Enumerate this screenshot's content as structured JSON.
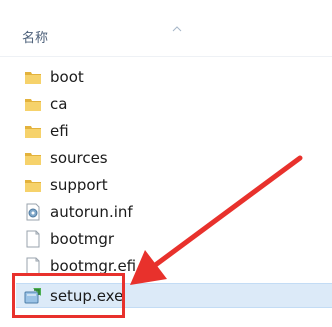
{
  "header": {
    "column_name": "名称"
  },
  "files": [
    {
      "name": "boot",
      "type": "folder",
      "icon": "folder-icon"
    },
    {
      "name": "ca",
      "type": "folder",
      "icon": "folder-icon"
    },
    {
      "name": "efi",
      "type": "folder",
      "icon": "folder-icon"
    },
    {
      "name": "sources",
      "type": "folder",
      "icon": "folder-icon"
    },
    {
      "name": "support",
      "type": "folder",
      "icon": "folder-icon"
    },
    {
      "name": "autorun.inf",
      "type": "file",
      "icon": "settings-file-icon"
    },
    {
      "name": "bootmgr",
      "type": "file",
      "icon": "blank-file-icon"
    },
    {
      "name": "bootmgr.efi",
      "type": "file",
      "icon": "blank-file-icon"
    },
    {
      "name": "setup.exe",
      "type": "exe",
      "icon": "setup-exe-icon",
      "selected": true
    }
  ],
  "colors": {
    "annotation": "#e8312c",
    "selection": "#dceaf8",
    "folder": "#f0c24a"
  }
}
